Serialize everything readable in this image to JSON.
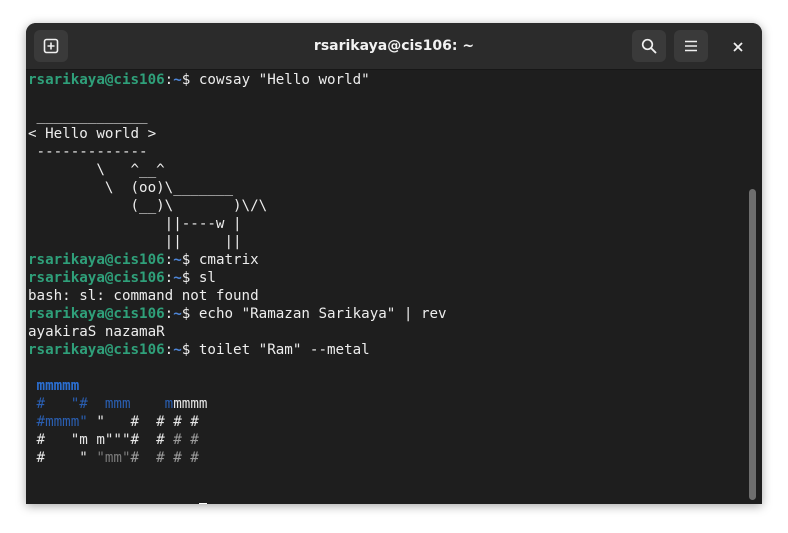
{
  "window": {
    "title": "rsarikaya@cis106: ~",
    "new_tab_icon": "new-tab-icon",
    "search_icon": "search-icon",
    "menu_icon": "hamburger-menu-icon",
    "close_icon": "close-icon"
  },
  "colors": {
    "prompt_user": "#2fa07a",
    "prompt_path": "#4e86d8",
    "metal_blue": "#2b6fd2"
  },
  "prompt": {
    "user": "rsarikaya@cis106",
    "sep": ":",
    "path": "~",
    "symbol": "$ "
  },
  "commands": {
    "c1": "cowsay \"Hello world\"",
    "c2": "cmatrix",
    "c3": "sl",
    "c4": "echo \"Ramazan Sarikaya\" | rev",
    "c5": "toilet \"Ram\" --metal"
  },
  "cowsay": [
    " _____________",
    "< Hello world >",
    " -------------",
    "        \\   ^__^",
    "         \\  (oo)\\_______",
    "            (__)\\       )\\/\\",
    "                ||----w |",
    "                ||     ||"
  ],
  "outputs": {
    "sl_error": "bash: sl: command not found",
    "rev_result": "ayakiraS nazamaR"
  },
  "toilet": {
    "r1a": " mmmmm",
    "r2a": " #   \"#",
    "r2b": "  mmm   ",
    "r2c": " m",
    "r2d": "mmmm",
    "r3a": " #mmmm\"",
    "r3b": " \"   #  # # #",
    "r4a": " #   \"m m\"\"\"#  #",
    "r4b": " # #",
    "r5a": " #    \" ",
    "r5b": "\"mm\"",
    "r5c": "#  # # #"
  }
}
